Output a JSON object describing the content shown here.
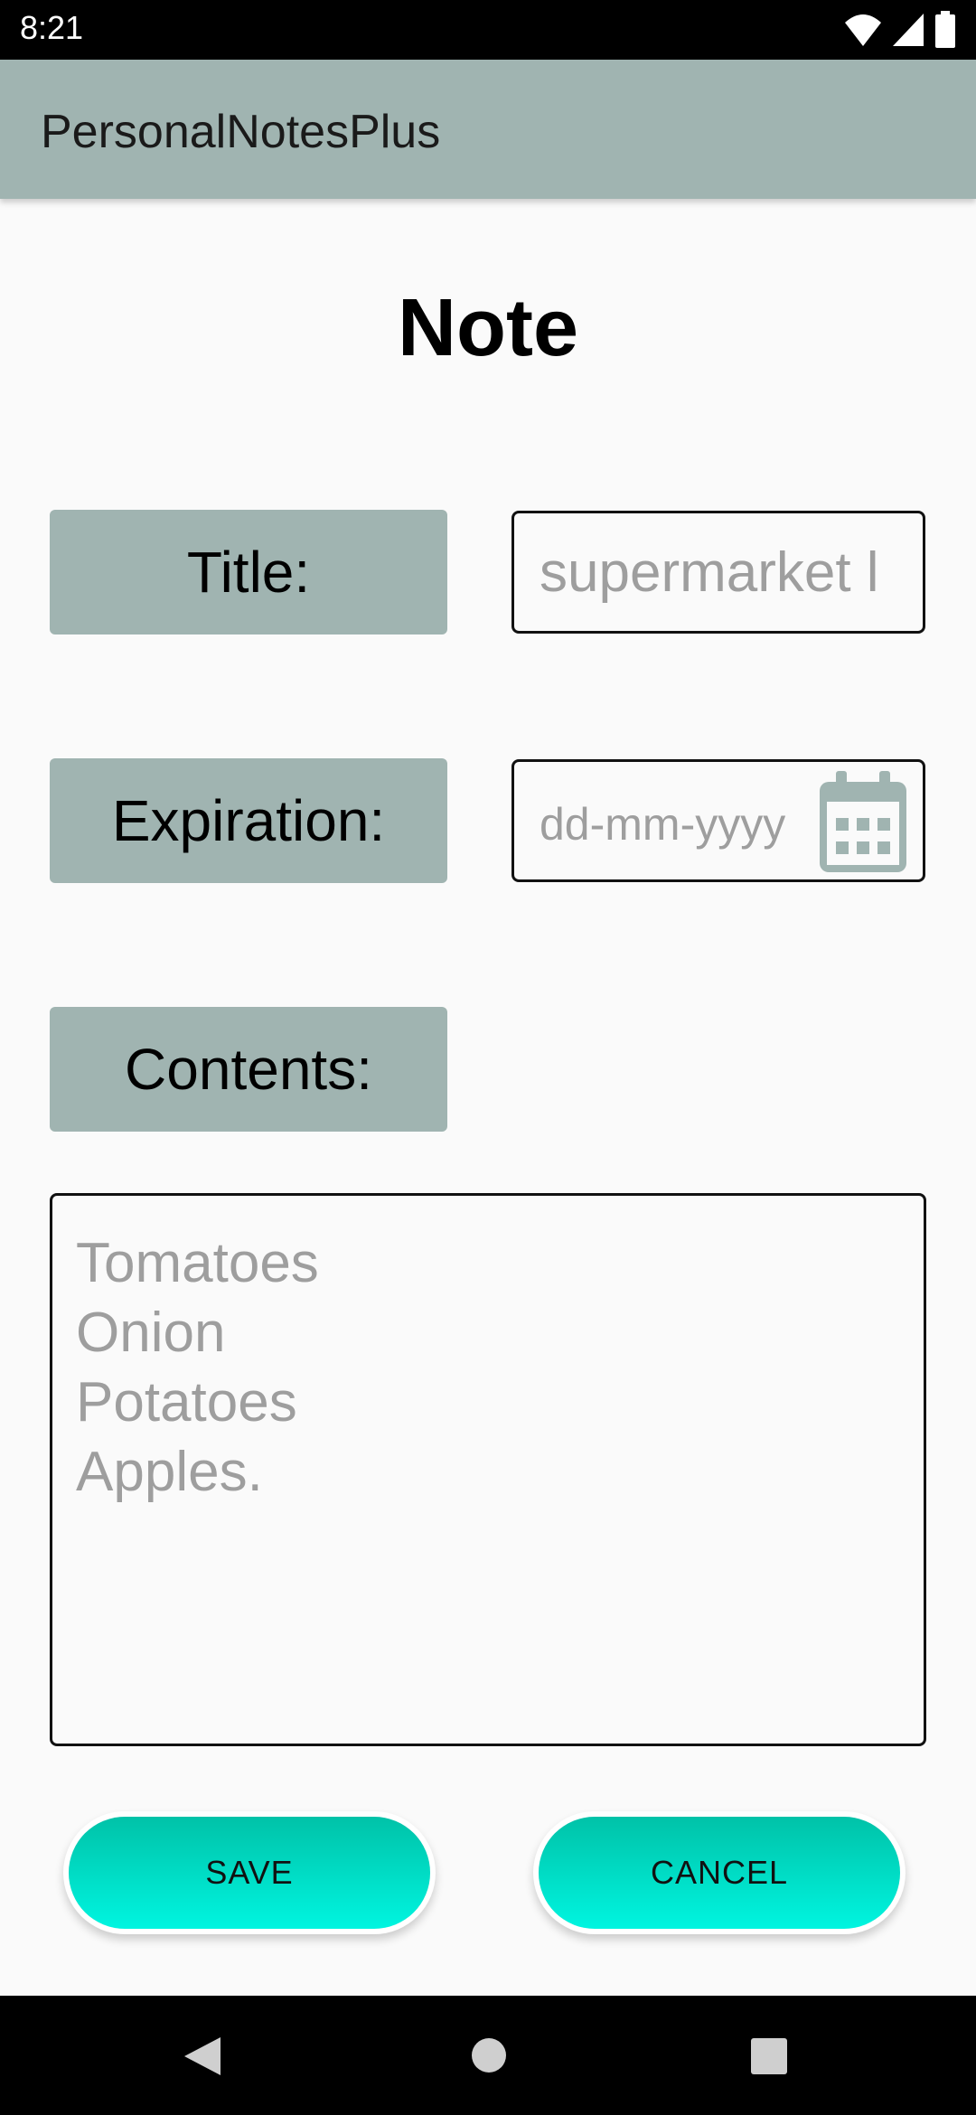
{
  "status_bar": {
    "time": "8:21",
    "icons": [
      "wifi-icon",
      "signal-icon",
      "battery-icon"
    ]
  },
  "app_bar": {
    "title": "PersonalNotesPlus"
  },
  "page": {
    "title": "Note"
  },
  "form": {
    "title_label": "Title:",
    "title_value": "supermarket l",
    "expiration_label": "Expiration:",
    "expiration_placeholder": "dd-mm-yyyy",
    "contents_label": "Contents:",
    "contents_lines": [
      "Tomatoes",
      "Onion",
      "Potatoes",
      "Apples."
    ]
  },
  "buttons": {
    "save_label": "SAVE",
    "cancel_label": "CANCEL"
  },
  "nav": {
    "icons": [
      "back-icon",
      "home-icon",
      "recents-icon"
    ]
  },
  "colors": {
    "app_bar": "#a0b4b1",
    "label_box": "#a0b4b1",
    "button_top": "#00c2a8",
    "button_bottom": "#00f5e0",
    "placeholder_text": "#9e9e9e"
  }
}
